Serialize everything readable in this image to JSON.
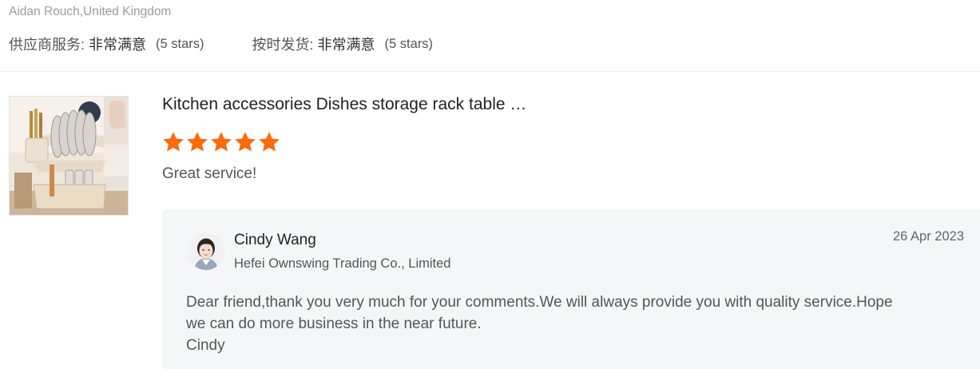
{
  "reviewer": {
    "name_location": "Aidan Rouch,United Kingdom"
  },
  "supplier_ratings": [
    {
      "label": "供应商服务:",
      "value": "非常满意",
      "stars": "(5 stars)",
      "star_count": 5
    },
    {
      "label": "按时发货:",
      "value": "非常满意",
      "stars": "(5 stars)",
      "star_count": 5
    }
  ],
  "product": {
    "title": "Kitchen accessories Dishes storage rack table …",
    "thumbnail_icon": "dish-rack-image",
    "rating": 5,
    "review": "Great service!"
  },
  "reply": {
    "name": "Cindy Wang",
    "company": "Hefei Ownswing Trading Co., Limited",
    "date": "26 Apr 2023",
    "lines": [
      "Dear friend,thank you very much for your comments.We will always provide you with quality service.Hope",
      "we can do more business in the near future.",
      "Cindy"
    ]
  },
  "colors": {
    "star": "#f96b0d",
    "reply_bg": "#f5f6f8",
    "divider": "#ececec",
    "muted_text": "#9b9b9b"
  }
}
